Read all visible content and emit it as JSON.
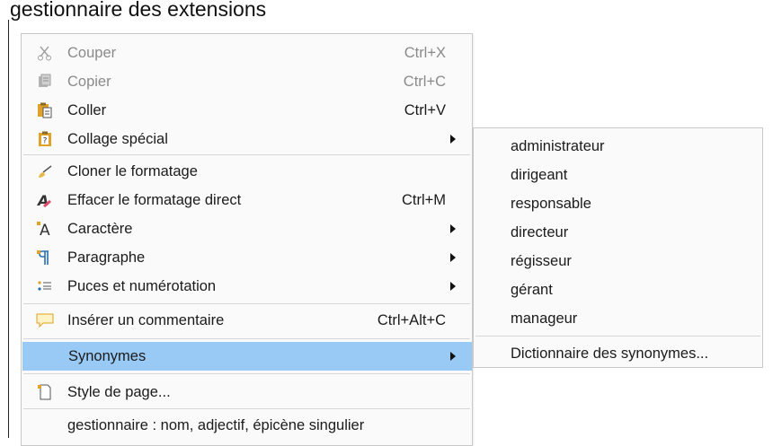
{
  "document": {
    "text": "gestionnaire des extensions"
  },
  "context_menu": {
    "items": [
      {
        "label": "Couper",
        "shortcut": "Ctrl+X",
        "icon": "scissors-icon"
      },
      {
        "label": "Copier",
        "shortcut": "Ctrl+C",
        "icon": "copy-icon"
      },
      {
        "label": "Coller",
        "shortcut": "Ctrl+V",
        "icon": "paste-icon"
      },
      {
        "label": "Collage spécial",
        "icon": "paste-special-icon"
      },
      {
        "label": "Cloner le formatage",
        "icon": "clone-format-brush-icon"
      },
      {
        "label": "Effacer le formatage direct",
        "shortcut": "Ctrl+M",
        "icon": "clear-format-icon"
      },
      {
        "label": "Caractère",
        "icon": "character-icon"
      },
      {
        "label": "Paragraphe",
        "icon": "paragraph-icon"
      },
      {
        "label": "Puces et numérotation",
        "icon": "bullets-numbering-icon"
      },
      {
        "label": "Insérer un commentaire",
        "shortcut": "Ctrl+Alt+C",
        "icon": "comment-icon"
      },
      {
        "label": "Synonymes"
      },
      {
        "label": "Style de page...",
        "icon": "page-style-icon"
      },
      {
        "label": "gestionnaire :  nom, adjectif, épicène singulier"
      }
    ]
  },
  "synonyms_submenu": {
    "items": [
      "administrateur",
      "dirigeant",
      "responsable",
      "directeur",
      "régisseur",
      "gérant",
      "manageur"
    ],
    "thesaurus_label": "Dictionnaire des synonymes..."
  },
  "colors": {
    "highlight": "#99c9f5",
    "menu_bg": "#fafafa",
    "border": "#c8c8c8"
  }
}
